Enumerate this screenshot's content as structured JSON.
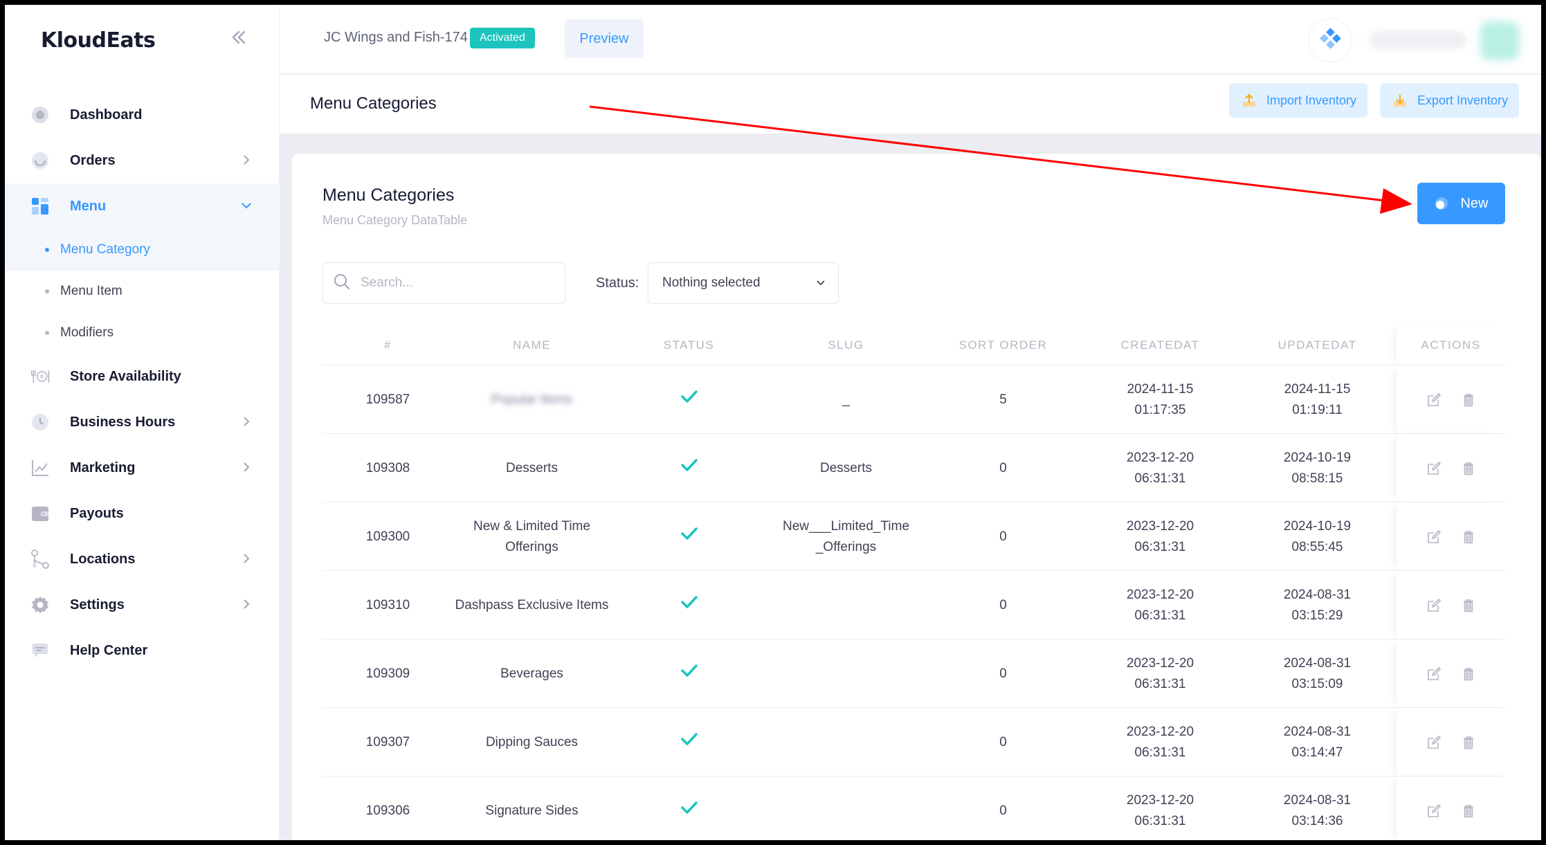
{
  "brand": "KloudEats",
  "sidebar": {
    "items": [
      {
        "label": "Dashboard",
        "icon": "dashboard-icon"
      },
      {
        "label": "Orders",
        "icon": "orders-icon"
      },
      {
        "label": "Menu",
        "icon": "menu-icon"
      },
      {
        "label": "Store Availability",
        "icon": "store-availability-icon"
      },
      {
        "label": "Business Hours",
        "icon": "clock-icon"
      },
      {
        "label": "Marketing",
        "icon": "chart-line-icon"
      },
      {
        "label": "Payouts",
        "icon": "wallet-icon"
      },
      {
        "label": "Locations",
        "icon": "locations-icon"
      },
      {
        "label": "Settings",
        "icon": "gear-icon"
      },
      {
        "label": "Help Center",
        "icon": "chat-icon"
      }
    ],
    "menu_sub": [
      "Menu Category",
      "Menu Item",
      "Modifiers"
    ]
  },
  "topbar": {
    "store_name": "JC Wings and Fish-174",
    "badge": "Activated",
    "preview": "Preview"
  },
  "subheader": {
    "title": "Menu Categories",
    "import": "Import Inventory",
    "export": "Export Inventory"
  },
  "card": {
    "title": "Menu Categories",
    "subtitle": "Menu Category DataTable",
    "new_button": "New",
    "search_placeholder": "Search...",
    "status_label": "Status:",
    "status_value": "Nothing selected"
  },
  "table": {
    "columns": [
      "#",
      "Name",
      "Status",
      "Slug",
      "Sort Order",
      "CreatedAt",
      "UpdatedAt",
      "Actions"
    ],
    "rows": [
      {
        "id": "109587",
        "name": "Popular Items",
        "blurred": true,
        "slug": "_",
        "sort": "5",
        "created_date": "2024-11-15",
        "created_time": "01:17:35",
        "updated_date": "2024-11-15",
        "updated_time": "01:19:11"
      },
      {
        "id": "109308",
        "name": "Desserts",
        "slug": "Desserts",
        "sort": "0",
        "created_date": "2023-12-20",
        "created_time": "06:31:31",
        "updated_date": "2024-10-19",
        "updated_time": "08:58:15"
      },
      {
        "id": "109300",
        "name": "New & Limited Time Offerings",
        "slug": "New___Limited_Time _Offerings",
        "sort": "0",
        "created_date": "2023-12-20",
        "created_time": "06:31:31",
        "updated_date": "2024-10-19",
        "updated_time": "08:55:45"
      },
      {
        "id": "109310",
        "name": "Dashpass Exclusive Items",
        "slug": "",
        "sort": "0",
        "created_date": "2023-12-20",
        "created_time": "06:31:31",
        "updated_date": "2024-08-31",
        "updated_time": "03:15:29"
      },
      {
        "id": "109309",
        "name": "Beverages",
        "slug": "",
        "sort": "0",
        "created_date": "2023-12-20",
        "created_time": "06:31:31",
        "updated_date": "2024-08-31",
        "updated_time": "03:15:09"
      },
      {
        "id": "109307",
        "name": "Dipping Sauces",
        "slug": "",
        "sort": "0",
        "created_date": "2023-12-20",
        "created_time": "06:31:31",
        "updated_date": "2024-08-31",
        "updated_time": "03:14:47"
      },
      {
        "id": "109306",
        "name": "Signature Sides",
        "slug": "",
        "sort": "0",
        "created_date": "2023-12-20",
        "created_time": "06:31:31",
        "updated_date": "2024-08-31",
        "updated_time": "03:14:36"
      }
    ]
  },
  "colors": {
    "primary": "#3699ff",
    "success": "#1bc5bd",
    "annotation": "#ff0000"
  }
}
